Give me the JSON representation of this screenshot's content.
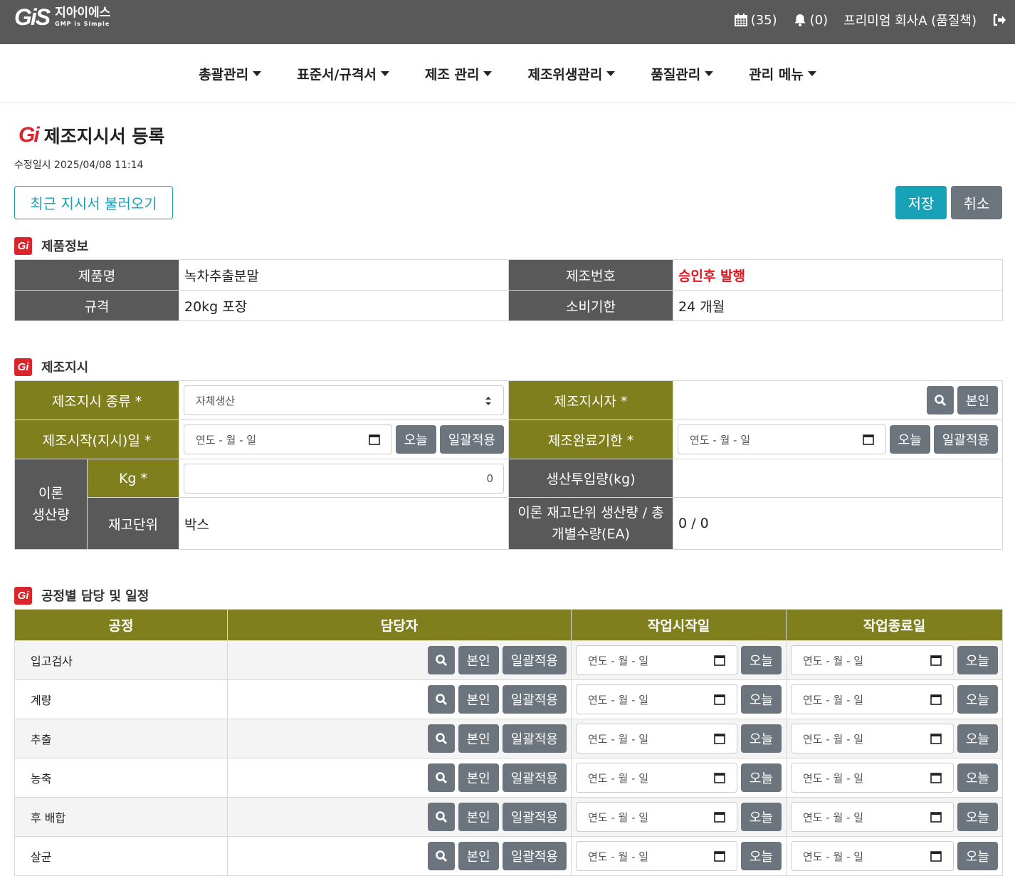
{
  "header": {
    "logo_mark": "GiS",
    "logo_ko": "지아이에스",
    "logo_slogan": "GMP is Simple",
    "calendar_count": "(35)",
    "bell_count": "(0)",
    "user": "프리미엄 회사A (품질책)"
  },
  "nav": [
    "총괄관리",
    "표준서/규격서",
    "제조 관리",
    "제조위생관리",
    "품질관리",
    "관리 메뉴"
  ],
  "page": {
    "title": "제조지시서 등록",
    "modified": "수정일시 2025/04/08 11:14",
    "load_recent": "최근 지시서 불러오기",
    "save": "저장",
    "cancel": "취소"
  },
  "product": {
    "section": "제품정보",
    "name_label": "제품명",
    "name": "녹차추출분말",
    "lot_label": "제조번호",
    "lot": "승인후 발행",
    "spec_label": "규격",
    "spec": "20kg 포장",
    "expiry_label": "소비기한",
    "expiry": "24 개월"
  },
  "order": {
    "section": "제조지시",
    "type_label": "제조지시 종류 *",
    "type_value": "자체생산",
    "orderer_label": "제조지시자 *",
    "self": "본인",
    "start_label": "제조시작(지시)일 *",
    "date_placeholder": "연도 - 월 - 일",
    "today": "오늘",
    "apply_all": "일괄적용",
    "due_label": "제조완료기한 *",
    "theory_label": "이론\n생산량",
    "kg_label": "Kg *",
    "kg_value": "0",
    "input_label": "생산투입량(kg)",
    "unit_label": "재고단위",
    "unit_value": "박스",
    "theory_unit_label": "이론 재고단위 생산량 / 총 개별수량(EA)",
    "theory_unit_value": "0 / 0"
  },
  "process": {
    "section": "공정별 담당 및 일정",
    "headers": [
      "공정",
      "담당자",
      "작업시작일",
      "작업종료일"
    ],
    "rows": [
      "입고검사",
      "계량",
      "추출",
      "농축",
      "후 배합",
      "살균"
    ]
  },
  "colors": {
    "topbar": "#595959",
    "olive": "#7f7f1e",
    "teal": "#17a2b8",
    "gray_btn": "#6c757d",
    "red": "#d9262d"
  }
}
